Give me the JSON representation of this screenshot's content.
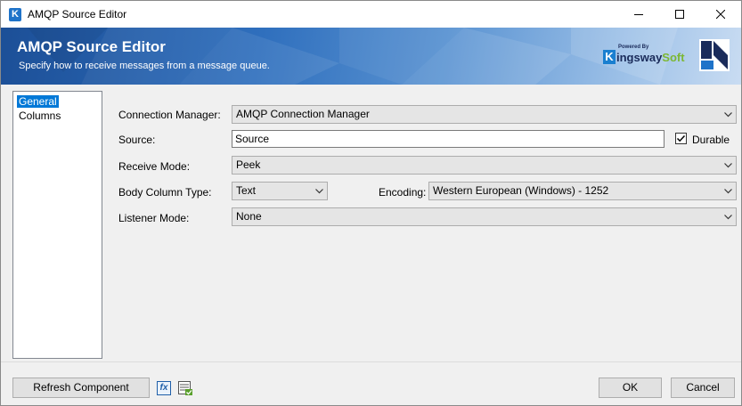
{
  "window": {
    "title": "AMQP Source Editor",
    "app_icon": "K"
  },
  "banner": {
    "title": "AMQP Source Editor",
    "subtitle": "Specify how to receive messages from a message queue.",
    "logo_powered": "Powered By",
    "logo_k": "K",
    "logo_ingsway": "ingsway",
    "logo_soft": "Soft"
  },
  "nav": {
    "items": [
      {
        "label": "General",
        "selected": true
      },
      {
        "label": "Columns",
        "selected": false
      }
    ]
  },
  "form": {
    "connection_manager": {
      "label": "Connection Manager:",
      "value": "AMQP Connection Manager"
    },
    "source": {
      "label": "Source:",
      "value": "Source"
    },
    "durable": {
      "label": "Durable",
      "checked": true
    },
    "receive_mode": {
      "label": "Receive Mode:",
      "value": "Peek"
    },
    "body_column_type": {
      "label": "Body Column Type:",
      "value": "Text"
    },
    "encoding": {
      "label": "Encoding:",
      "value": "Western European (Windows) - 1252"
    },
    "listener_mode": {
      "label": "Listener Mode:",
      "value": "None"
    }
  },
  "footer": {
    "refresh_label": "Refresh Component",
    "fx_icon_text": "fx",
    "ok_label": "OK",
    "cancel_label": "Cancel"
  },
  "colors": {
    "selection": "#0078d7",
    "banner_dark": "#1c4f97",
    "banner_light": "#c9dcf2",
    "kingsway_green": "#7cb733"
  }
}
